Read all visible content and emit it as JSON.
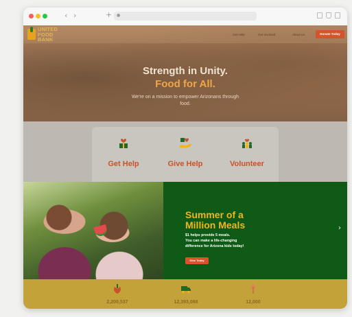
{
  "browser": {
    "colors": {
      "close": "#ff5f57",
      "minimize": "#febc2e",
      "zoom": "#28c840"
    },
    "back_label": "‹",
    "forward_label": "›",
    "new_tab_label": "+"
  },
  "site": {
    "logo": {
      "line1": "UNITED",
      "line2": "FOOD",
      "line3": "BANK"
    },
    "nav": [
      "Get Help",
      "Get Involved",
      "About Us"
    ],
    "donate_label": "Donate Today",
    "hero": {
      "title_line1": "Strength in Unity.",
      "title_line2": "Food for All.",
      "subtitle": "We're on a mission to empower Arizonans through food."
    },
    "actions": [
      {
        "label": "Get Help",
        "icon": "gift-heart-icon"
      },
      {
        "label": "Give Help",
        "icon": "giving-hand-icon"
      },
      {
        "label": "Volunteer",
        "icon": "volunteers-icon"
      }
    ],
    "promo": {
      "title_line1": "Summer of a",
      "title_line2": "Million Meals",
      "body_line1": "$1 helps provide 5 meals.",
      "body_line2": "You can make a life-changing",
      "body_line3": "difference for Arizona kids today!",
      "button_label": "Give Today",
      "next_label": "›"
    },
    "stats": [
      {
        "value": "2,200,537",
        "icon": "produce-icon"
      },
      {
        "value": "12,393,068",
        "icon": "truck-icon"
      },
      {
        "value": "12,000",
        "icon": "wheat-icon"
      }
    ],
    "colors": {
      "accent_orange": "#d2552b",
      "brand_green": "#0f5a16",
      "brand_gold": "#f2b51d"
    }
  }
}
